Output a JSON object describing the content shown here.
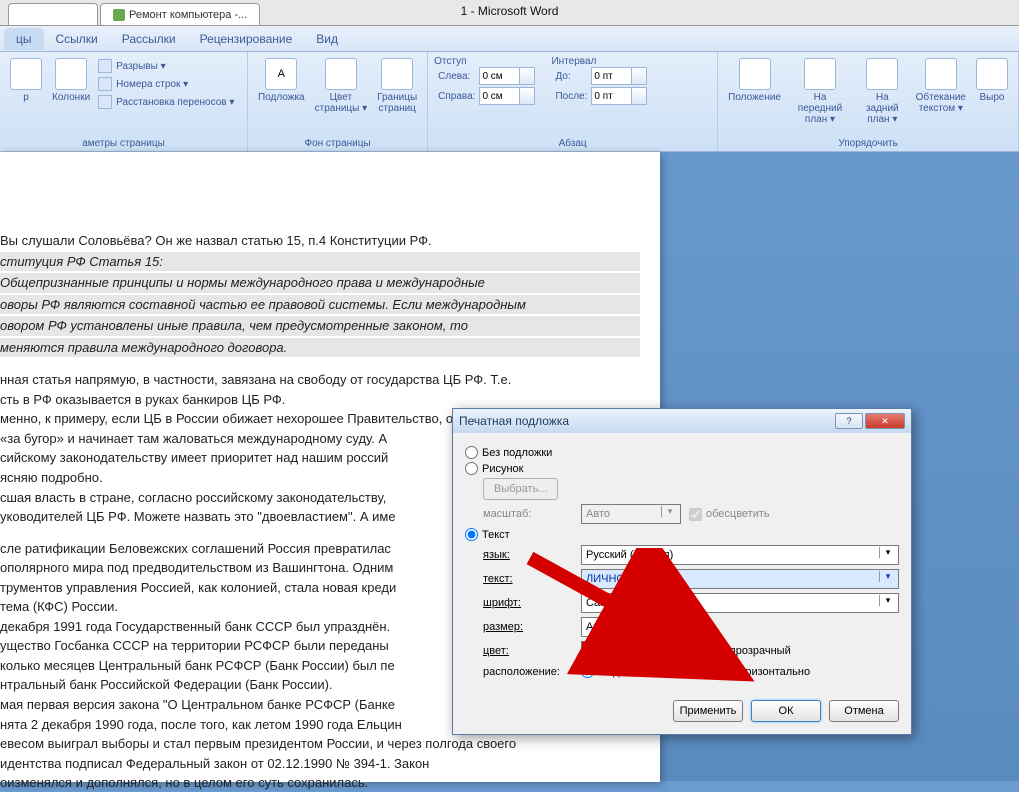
{
  "window": {
    "title": "1 - Microsoft Word"
  },
  "browser": {
    "tab_b": "Ремонт компьютера -..."
  },
  "ribbon_tabs": [
    "цы",
    "Ссылки",
    "Рассылки",
    "Рецензирование",
    "Вид"
  ],
  "groups": {
    "page_setup": {
      "poly": "р",
      "cols": "Колонки",
      "breaks": "Разрывы ▾",
      "lines": "Номера строк ▾",
      "hyph": "Расстановка переносов ▾",
      "label": "аметры страницы"
    },
    "page_bg": {
      "watermark": "Подложка",
      "color": "Цвет\nстраницы ▾",
      "borders": "Границы\nстраниц",
      "label": "Фон страницы"
    },
    "indent": {
      "title_indent": "Отступ",
      "title_spacing": "Интервал",
      "left": "Слева:",
      "right": "Справа:",
      "before": "До:",
      "after": "После:",
      "v_left": "0 см",
      "v_right": "0 см",
      "v_before": "0 пт",
      "v_after": "0 пт",
      "label": "Абзац"
    },
    "arrange": {
      "position": "Положение",
      "front": "На передний\nплан ▾",
      "back": "На задний\nплан ▾",
      "wrap": "Обтекание\nтекстом ▾",
      "sel": "Выро",
      "label": "Упорядочить"
    }
  },
  "doc": {
    "l1": "Вы слушали Соловьёва? Он же назвал статью 15, п.4 Конституции РФ.",
    "l2": "ституция РФ Статья 15:",
    "l3": "Общепризнанные принципы и нормы международного права и международные",
    "l4": "оворы РФ являются составной частью ее правовой системы. Если международным",
    "l5": "овором РФ установлены иные правила, чем предусмотренные законом, то",
    "l6": "меняются правила международного договора.",
    "l7": "нная статья напрямую, в частности, завязана на свободу от государства ЦБ РФ. Т.е.",
    "l8": "сть в РФ оказывается в руках банкиров ЦБ РФ.",
    "l9": "менно, к примеру, если ЦБ в России обижает нехорошее Правительство, он идёт куда-",
    "l10": "«за бугор» и начинает там жаловаться международному суду. А ",
    "l11": "сийскому законодательству имеет приоритет над нашим россий",
    "l12": "ясняю подробно.",
    "l13": "сшая власть в стране, согласно российскому законодательству,",
    "l14": "уководителей ЦБ РФ. Можете назвать это \"двоевластием\". А име",
    "l15": "сле ратификации Беловежских соглашений Россия превратилас",
    "l16": "ополярного мира под предводительством из Вашингтона. Одним",
    "l17": "трументов управления Россией, как колонией, стала новая креди",
    "l18": "тема (КФС) России.",
    "l19": "декабря 1991 года Государственный банк СССР был упразднён.",
    "l20": "ущество Госбанка СССР на территории РСФСР были переданы",
    "l21": "колько месяцев Центральный банк РСФСР (Банк России) был пе",
    "l22": "нтральный банк Российской Федерации (Банк России).",
    "l23": "мая первая версия закона \"О Центральном банке РСФСР (Банке",
    "l24": "нята 2 декабря 1990 года, после того, как летом 1990 года Ельцин",
    "l25": "евесом выиграл выборы и стал первым президентом России, и через полгода своего",
    "l26": "идентства подписал Федеральный закон от 02.12.1990 № 394-1. Закон",
    "l27": "оизменялся и дополнялся, но в целом его суть сохранилась."
  },
  "dialog": {
    "title": "Печатная подложка",
    "opt_none": "Без подложки",
    "opt_pic": "Рисунок",
    "btn_select": "Выбрать...",
    "scale": "масштаб:",
    "scale_v": "Авто",
    "washout": "обесцветить",
    "opt_text": "Текст",
    "lang": "язык:",
    "lang_v": "Русский (Россия)",
    "text": "текст:",
    "text_v": "ЛИЧНОЕ",
    "font": "шрифт:",
    "font_v": "Calibri",
    "size": "размер:",
    "size_v": "Авто",
    "color": "цвет:",
    "semitrans": "полупрозрачный",
    "layout": "расположение:",
    "diag": "по диагонали",
    "horiz": "горизонтально",
    "apply": "Применить",
    "ok": "ОК",
    "cancel": "Отмена"
  }
}
